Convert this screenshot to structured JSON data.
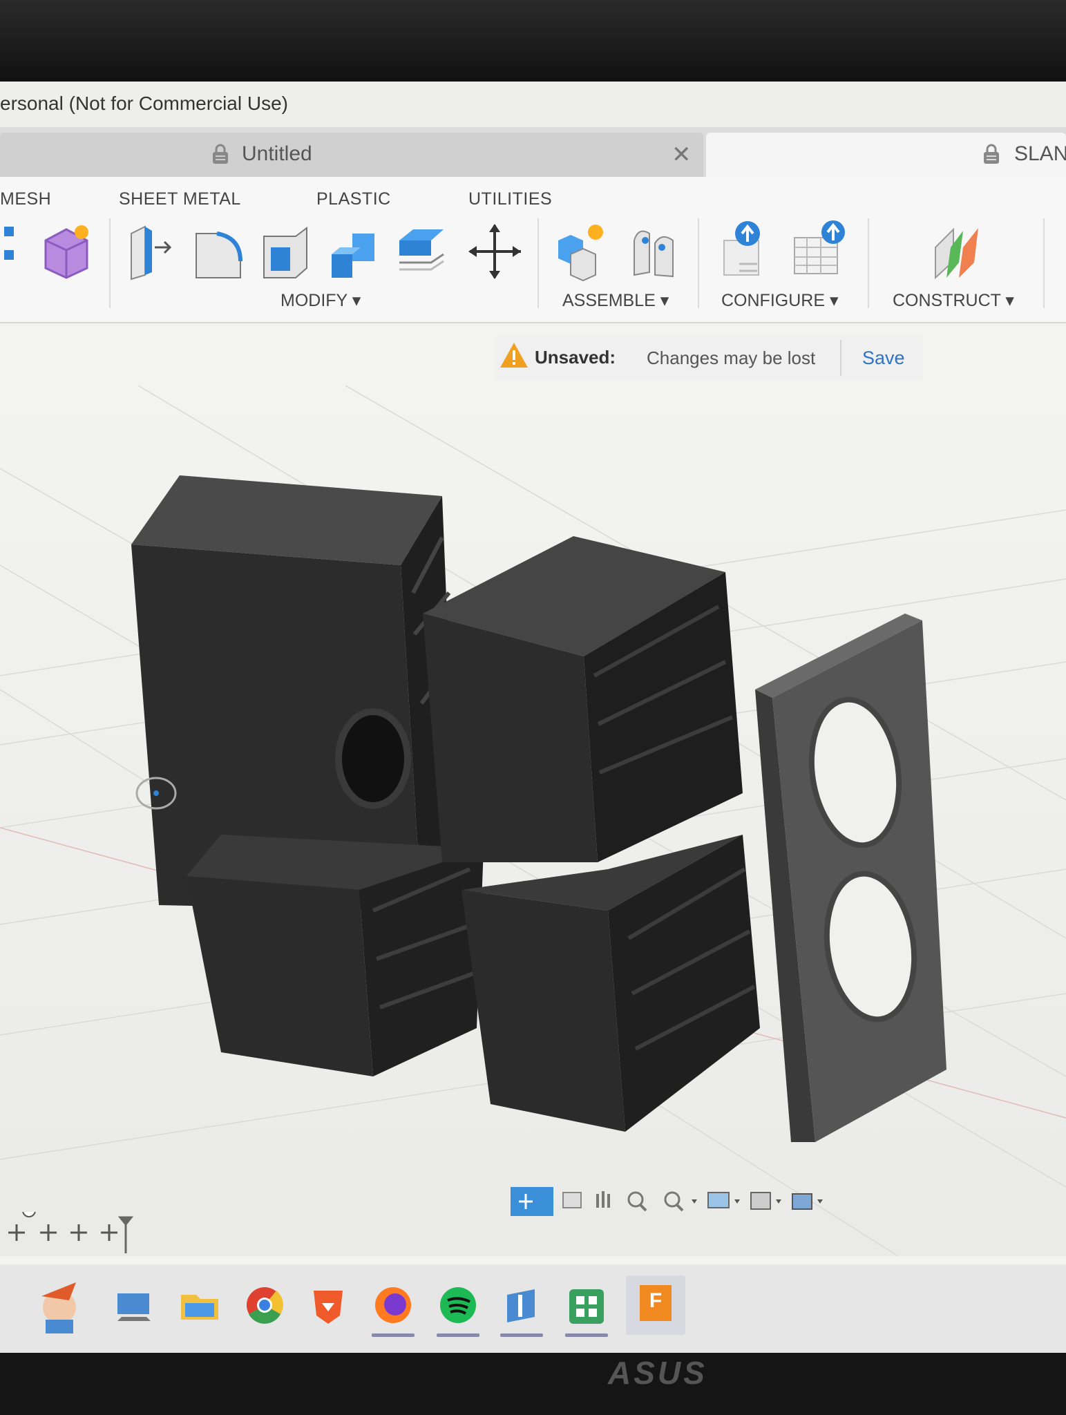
{
  "window": {
    "title_fragment": "ersonal (Not for Commercial Use)"
  },
  "tabs": [
    {
      "label": "Untitled"
    },
    {
      "label": "SLAN"
    }
  ],
  "ribbon": {
    "tabs": [
      "MESH",
      "SHEET METAL",
      "PLASTIC",
      "UTILITIES"
    ],
    "groups": {
      "modify": "MODIFY ▾",
      "assemble": "ASSEMBLE ▾",
      "configure": "CONFIGURE ▾",
      "construct": "CONSTRUCT ▾"
    }
  },
  "banner": {
    "status": "Unsaved:",
    "message": "Changes may be lost",
    "save_label": "Save"
  },
  "monitor": {
    "brand": "ASUS"
  },
  "colors": {
    "accent_blue": "#2f73c5",
    "warning": "#f0a020",
    "model": "#2e2e2e"
  },
  "taskbar": {
    "icons": [
      "mascot-icon",
      "desktop-icon",
      "file-explorer-icon",
      "chrome-icon",
      "brave-icon",
      "firefox-icon",
      "spotify-icon",
      "app-icon",
      "store-icon",
      "fusion-icon"
    ]
  },
  "taskbar_fusion_label": "F"
}
